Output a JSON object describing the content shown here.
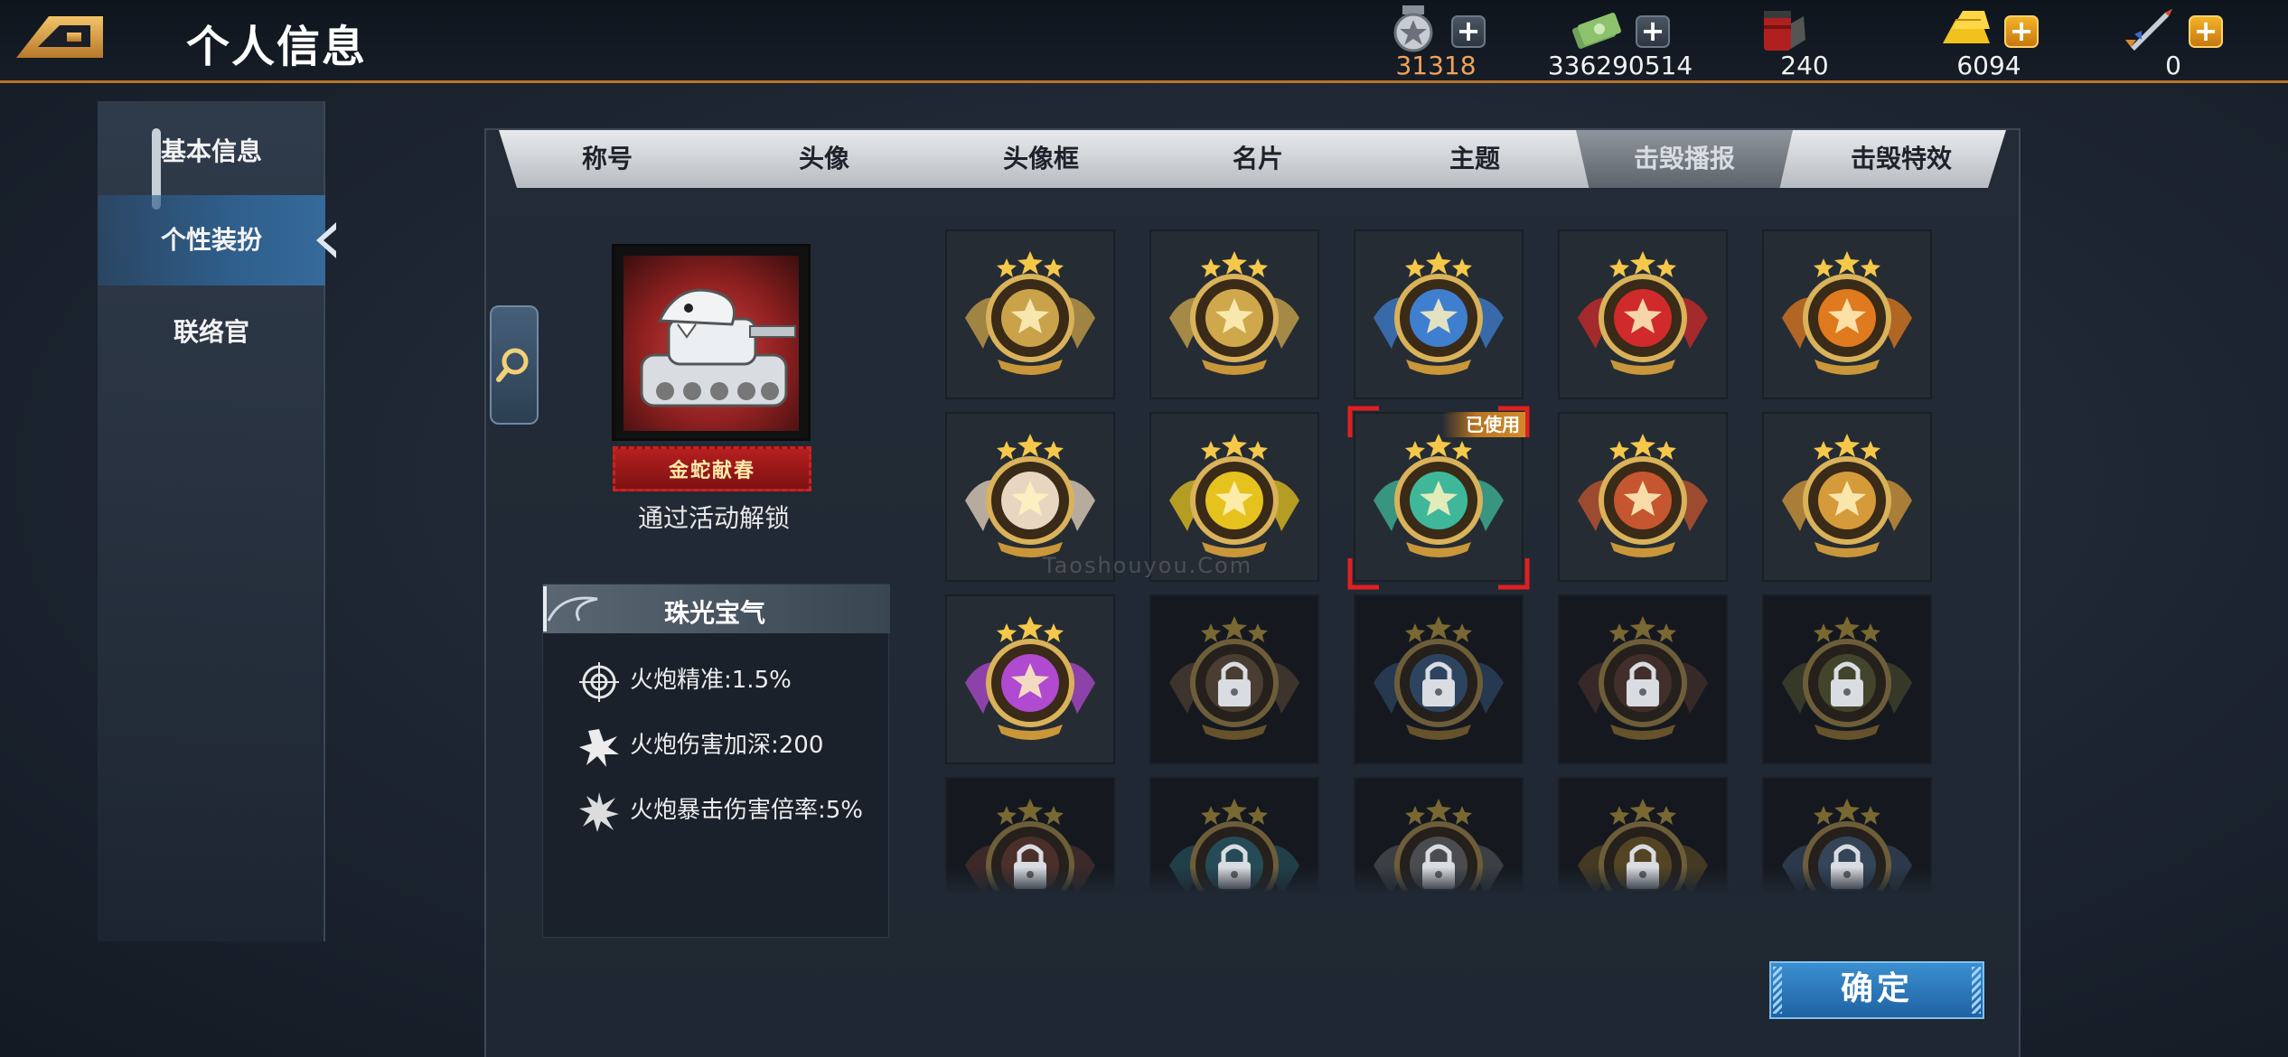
{
  "header": {
    "title": "个人信息"
  },
  "resources": [
    {
      "name": "medal-token",
      "value": "31318",
      "has_plus": true,
      "plus_style": "gray",
      "value_color": "#f0a25a"
    },
    {
      "name": "cash",
      "value": "336290514",
      "has_plus": true,
      "plus_style": "gray",
      "value_color": "#f2f2f2"
    },
    {
      "name": "fuel-barrel",
      "value": "240",
      "has_plus": false,
      "value_color": "#f2f2f2"
    },
    {
      "name": "gold-bars",
      "value": "6094",
      "has_plus": true,
      "plus_style": "gold",
      "value_color": "#f2f2f2"
    },
    {
      "name": "rocket",
      "value": "0",
      "has_plus": true,
      "plus_style": "gold",
      "value_color": "#f2f2f2"
    }
  ],
  "sidebar": {
    "items": [
      {
        "label": "基本信息",
        "active": false
      },
      {
        "label": "个性装扮",
        "active": true
      },
      {
        "label": "联络官",
        "active": false
      }
    ]
  },
  "tabs": [
    {
      "label": "称号",
      "active": false
    },
    {
      "label": "头像",
      "active": false
    },
    {
      "label": "头像框",
      "active": false
    },
    {
      "label": "名片",
      "active": false
    },
    {
      "label": "主题",
      "active": false
    },
    {
      "label": "击毁播报",
      "active": true
    },
    {
      "label": "击毁特效",
      "active": false
    }
  ],
  "preview": {
    "banner_text": "金蛇献春",
    "unlock_text": "通过活动解锁"
  },
  "stats": {
    "title": "珠光宝气",
    "rows": [
      {
        "icon": "crosshair-icon",
        "text": "火炮精准:1.5%"
      },
      {
        "icon": "explosion-icon",
        "text": "火炮伤害加深:200"
      },
      {
        "icon": "critical-burst-icon",
        "text": "火炮暴击伤害倍率:5%"
      }
    ]
  },
  "grid": {
    "used_label": "已使用",
    "items": [
      {
        "icon": "star-cross-emblem-icon",
        "locked": false,
        "color": "#c9a24a"
      },
      {
        "icon": "winged-sword-emblem-icon",
        "locked": false,
        "color": "#d0a84c"
      },
      {
        "icon": "open-book-emblem-icon",
        "locked": false,
        "color": "#3f7fd0"
      },
      {
        "icon": "red-star-wings-emblem-icon",
        "locked": false,
        "color": "#d02a2a"
      },
      {
        "icon": "pumpkin-emblem-icon",
        "locked": false,
        "color": "#e07a1e"
      },
      {
        "icon": "lantern-emblem-icon",
        "locked": false,
        "color": "#e8d6c0"
      },
      {
        "icon": "shield-emblem-icon",
        "locked": false,
        "color": "#e6c21e"
      },
      {
        "icon": "jade-ring-emblem-icon",
        "locked": false,
        "color": "#3fb89a",
        "used": true
      },
      {
        "icon": "red-star-ornate-emblem-icon",
        "locked": false,
        "color": "#c5562f"
      },
      {
        "icon": "golden-swirl-emblem-icon",
        "locked": false,
        "color": "#d59a3a"
      },
      {
        "icon": "purple-star-shield-emblem-icon",
        "locked": false,
        "color": "#b04ad0"
      },
      {
        "icon": "locked-emblem-icon",
        "locked": true,
        "color": "#8a6a4a"
      },
      {
        "icon": "locked-snowflake-emblem-icon",
        "locked": true,
        "color": "#4a7ab0"
      },
      {
        "icon": "locked-wreath-emblem-icon",
        "locked": true,
        "color": "#7a4a3a"
      },
      {
        "icon": "locked-vine-emblem-icon",
        "locked": true,
        "color": "#7a7a3a"
      },
      {
        "icon": "locked-emblem-icon",
        "locked": true,
        "color": "#8a4a3a"
      },
      {
        "icon": "locked-emblem-icon",
        "locked": true,
        "color": "#3a8a9a"
      },
      {
        "icon": "locked-emblem-icon",
        "locked": true,
        "color": "#8a8a8a"
      },
      {
        "icon": "locked-emblem-icon",
        "locked": true,
        "color": "#a0782a"
      },
      {
        "icon": "locked-emblem-icon",
        "locked": true,
        "color": "#5a7aa0"
      }
    ]
  },
  "actions": {
    "confirm_label": "确定"
  },
  "watermark": "Taoshouyou.Com"
}
